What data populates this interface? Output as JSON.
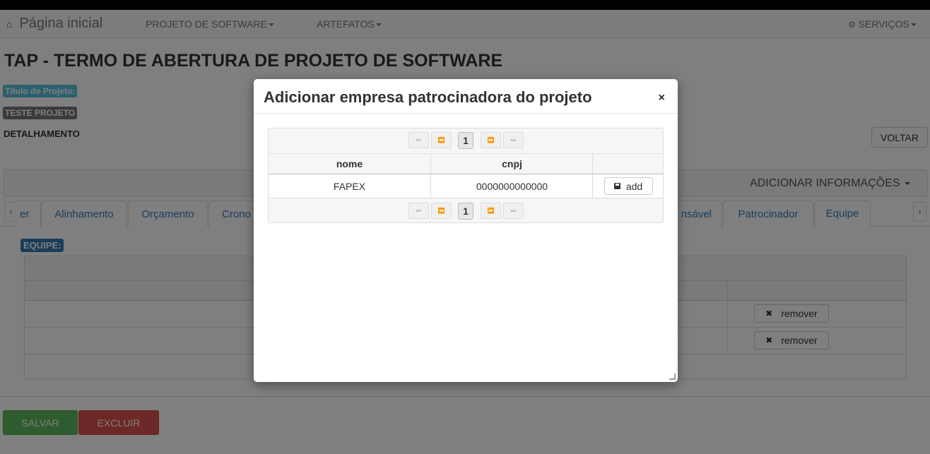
{
  "navbar": {
    "home_icon": "home-icon",
    "home_label": "Página inicial",
    "menu_projeto": "PROJETO DE SOFTWARE",
    "menu_artefatos": "ARTEFATOS",
    "servicos_icon": "gear-icon",
    "menu_servicos": "SERVIÇOS"
  },
  "page": {
    "title": "TAP - TERMO DE ABERTURA DE PROJETO DE SOFTWARE",
    "titulo_label": "Título do Projeto:",
    "titulo_value": "TESTE PROJETO",
    "detalhamento": "DETALHAMENTO",
    "voltar": "VOLTAR",
    "adicionar_info": "ADICIONAR INFORMAÇÕES"
  },
  "tabs": {
    "scroll_left": "‹",
    "scroll_right": "›",
    "items": [
      "er",
      "Alinhamento",
      "Orçamento",
      "Crono",
      "nsável",
      "Patrocinador",
      "Equipe"
    ]
  },
  "equipe": {
    "label": "EQUIPE:",
    "remove_icon": "close-icon",
    "remove_label": "remover"
  },
  "footer": {
    "salvar": "SALVAR",
    "excluir": "EXCLUIR"
  },
  "modal": {
    "title": "Adicionar empresa patrocinadora do projeto",
    "close": "×",
    "pager": {
      "first": "⏮",
      "prev": "⏪",
      "current_page": "1",
      "next": "⏩",
      "last": "⏭"
    },
    "columns": [
      "nome",
      "cnpj",
      ""
    ],
    "rows": [
      {
        "nome": "FAPEX",
        "cnpj": "0000000000000",
        "action": "add",
        "action_icon": "save-icon"
      }
    ]
  },
  "colors": {
    "primary": "#337ab7",
    "info": "#5bc0de",
    "success": "#5cb85c",
    "danger": "#d9534f"
  }
}
